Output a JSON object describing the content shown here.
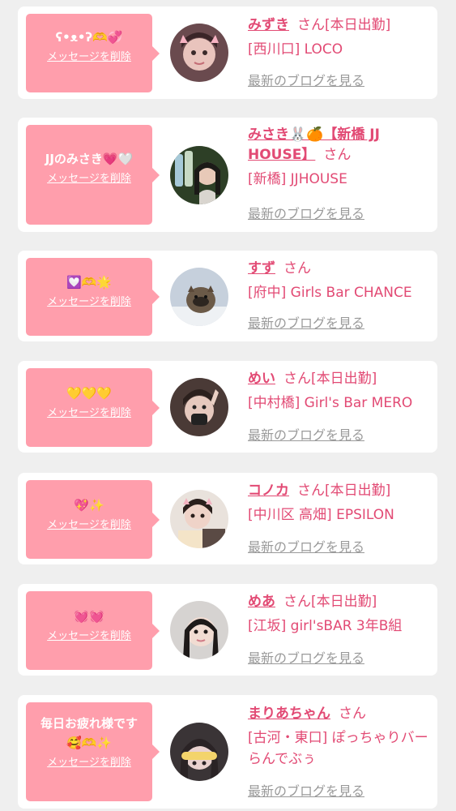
{
  "cards": [
    {
      "message": "ʕ•ᴥ•ʔ🫶💞",
      "delete_label": "メッセージを削除",
      "name": "みずき",
      "san": "さん",
      "status": "[本日出勤]",
      "shop": "[西川口] LOCO",
      "blog_label": "最新のブログを見る",
      "avatar": "user-avatar"
    },
    {
      "message": "JJのみさき💗🤍",
      "delete_label": "メッセージを削除",
      "name": "みさき🐰🍊【新橋 JJ HOUSE】",
      "san": "さん",
      "status": "",
      "shop": "[新橋] JJHOUSE",
      "blog_label": "最新のブログを見る",
      "avatar": "user-avatar"
    },
    {
      "message": "💟🫶🌟",
      "delete_label": "メッセージを削除",
      "name": "すず",
      "san": "さん",
      "status": "",
      "shop": "[府中] Girls Bar CHANCE",
      "blog_label": "最新のブログを見る",
      "avatar": "user-avatar"
    },
    {
      "message": "💛💛💛",
      "delete_label": "メッセージを削除",
      "name": "めい",
      "san": "さん",
      "status": "[本日出勤]",
      "shop": "[中村橋] Girl's Bar MERO",
      "blog_label": "最新のブログを見る",
      "avatar": "user-avatar"
    },
    {
      "message": "💖✨",
      "delete_label": "メッセージを削除",
      "name": "コノカ",
      "san": "さん",
      "status": "[本日出勤]",
      "shop": "[中川区 高畑] EPSILON",
      "blog_label": "最新のブログを見る",
      "avatar": "user-avatar"
    },
    {
      "message": "💓💓",
      "delete_label": "メッセージを削除",
      "name": "めあ",
      "san": "さん",
      "status": "[本日出勤]",
      "shop": "[江坂] girl'sBAR 3年B組",
      "blog_label": "最新のブログを見る",
      "avatar": "user-avatar"
    },
    {
      "message": "毎日お疲れ様です\n🥰🫶✨",
      "delete_label": "メッセージを削除",
      "name": "まりあちゃん",
      "san": "さん",
      "status": "",
      "shop": "[古河・東口] ぽっちゃりバー らんでぶぅ",
      "blog_label": "最新のブログを見る",
      "avatar": "user-avatar"
    }
  ]
}
